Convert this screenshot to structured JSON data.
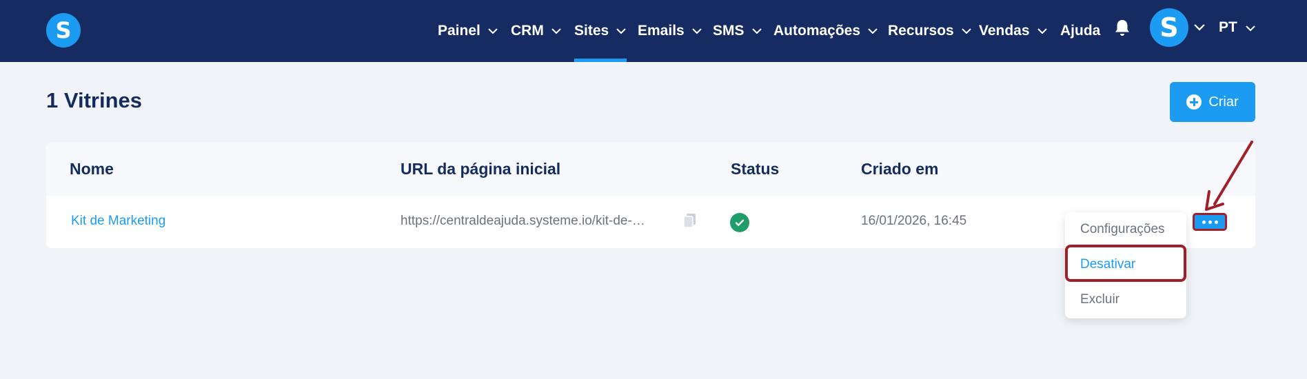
{
  "brand": {
    "logo_letter": "S"
  },
  "nav": {
    "items": [
      {
        "label": "Painel"
      },
      {
        "label": "CRM"
      },
      {
        "label": "Sites",
        "active": true
      },
      {
        "label": "Emails"
      },
      {
        "label": "SMS"
      },
      {
        "label": "Automações"
      },
      {
        "label": "Recursos"
      },
      {
        "label": "Vendas"
      },
      {
        "label": "Ajuda"
      }
    ],
    "avatar_letter": "S",
    "language": "PT"
  },
  "header": {
    "title": "1 Vitrines",
    "create_label": "Criar"
  },
  "table": {
    "columns": [
      "Nome",
      "URL da página inicial",
      "Status",
      "Criado em"
    ],
    "rows": [
      {
        "name": "Kit de Marketing",
        "url": "https://centraldeajuda.systeme.io/kit-de-…",
        "status": "active",
        "created": "16/01/2026, 16:45"
      }
    ]
  },
  "row_menu": {
    "items": [
      "Configurações",
      "Desativar",
      "Excluir"
    ],
    "highlighted": "Desativar"
  },
  "colors": {
    "nav_bg": "#152b61",
    "accent": "#1b9cf2",
    "annotation": "#a11f28",
    "status_ok": "#1f9d6a"
  }
}
